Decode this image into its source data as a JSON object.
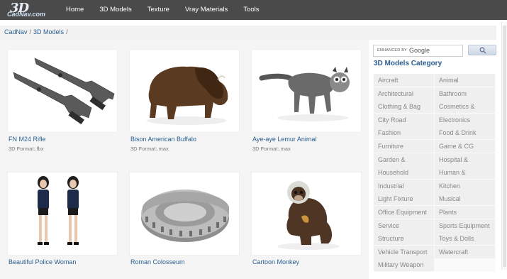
{
  "header": {
    "logo_mark": "3D",
    "logo_name": "CadNav.com",
    "nav": [
      "Home",
      "3D Models",
      "Texture",
      "Vray Materials",
      "Tools"
    ]
  },
  "breadcrumb": [
    "CadNav",
    "3D Models",
    ""
  ],
  "models": [
    {
      "title": "FN M24 Rifle",
      "format": "3D Format:.fbx",
      "icon": "rifle-icon"
    },
    {
      "title": "Bison American Buffalo",
      "format": "3D Format:.max",
      "icon": "bison-icon"
    },
    {
      "title": "Aye-aye Lemur Animal",
      "format": "3D Format:.max",
      "icon": "lemur-icon"
    },
    {
      "title": "Beautiful Police Woman",
      "format": "",
      "icon": "police-woman-icon"
    },
    {
      "title": "Roman Colosseum",
      "format": "",
      "icon": "colosseum-icon"
    },
    {
      "title": "Cartoon Monkey",
      "format": "",
      "icon": "monkey-icon"
    }
  ],
  "search": {
    "enhanced_label": "ENHANCED BY",
    "google_label": "Google",
    "value": ""
  },
  "sidebar": {
    "title": "3D Models Category",
    "categories": [
      "Aircraft",
      "Animal",
      "Architectural",
      "Bathroom",
      "Clothing & Bag",
      "Cosmetics &",
      "City Road",
      "Electronics",
      "Fashion",
      "Food & Drink",
      "Furniture",
      "Game & CG",
      "Garden &",
      "Hospital &",
      "Household",
      "Human &",
      "Industrial",
      "Kitchen",
      "Light Fixture",
      "Musical",
      "Office Equipment",
      "Plants",
      "Service",
      "Sports Equipment",
      "Structure",
      "Toys & Dolls",
      "Vehicle Transport",
      "Watercraft",
      "Military Weapon"
    ]
  },
  "colors": {
    "nav_bg": "#4a4a4a",
    "link": "#2a5d8f",
    "category_bg": "#efefef"
  }
}
